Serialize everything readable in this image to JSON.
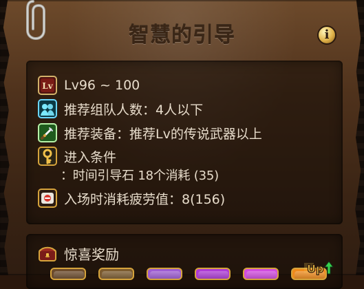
{
  "panel": {
    "title": "智慧的引导",
    "info_icon": "info-icon",
    "info_glyph": "i",
    "clip_icon": "paperclip-icon"
  },
  "requirements": {
    "level": {
      "icon": "level-lv-icon",
      "icon_text": "Lv",
      "text": "Lv96 ~ 100"
    },
    "party": {
      "icon": "party-members-icon",
      "text": "推荐组队人数：4人以下"
    },
    "equipment": {
      "icon": "sword-icon",
      "text": "推荐装备：推荐Lv的传说武器以上"
    },
    "entry": {
      "icon": "key-icon",
      "label": "进入条件",
      "detail": "：时间引导石 18个消耗 (35)"
    },
    "fatigue": {
      "icon": "fatigue-icon",
      "text": "入场时消耗疲劳值：8(156)"
    }
  },
  "reward": {
    "icon": "treasure-chest-icon",
    "title": "惊喜奖励",
    "slots": [
      {
        "name": "reward-slot-1",
        "color": "#6b4a2b"
      },
      {
        "name": "reward-slot-2",
        "color": "#7b5a2e"
      },
      {
        "name": "reward-slot-3",
        "color": "#9d5bd3"
      },
      {
        "name": "reward-slot-4",
        "color": "#ad39d6"
      },
      {
        "name": "reward-slot-5",
        "color": "#d14ae0"
      },
      {
        "name": "reward-slot-6",
        "color": "#f08a1b"
      }
    ],
    "up_badge_icon": "up-arrow-icon",
    "up_badge_text": "Up"
  },
  "colors": {
    "text": "#e7dccb",
    "title": "#3a2616",
    "section_bg": "#140c07",
    "gold": "#d6a43c"
  }
}
